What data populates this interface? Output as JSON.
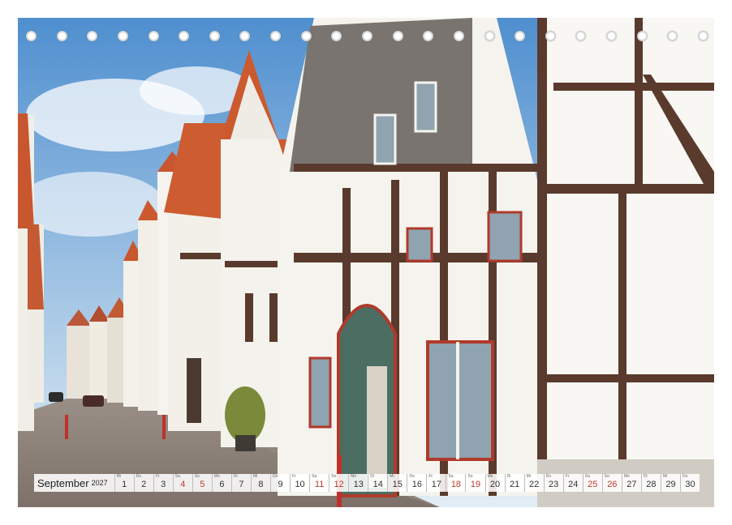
{
  "calendar": {
    "month": "September",
    "year": "2027",
    "weekday_initials": [
      "Mi",
      "Do",
      "Fr",
      "Sa",
      "So",
      "Mo",
      "Di",
      "Mi",
      "Do",
      "Fr",
      "Sa",
      "So",
      "Mo",
      "Di",
      "Mi",
      "Do",
      "Fr",
      "Sa",
      "So",
      "Mo",
      "Di",
      "Mi",
      "Do",
      "Fr",
      "Sa",
      "So",
      "Mo",
      "Di",
      "Mi",
      "Do"
    ],
    "days": [
      "1",
      "2",
      "3",
      "4",
      "5",
      "6",
      "7",
      "8",
      "9",
      "10",
      "11",
      "12",
      "13",
      "14",
      "15",
      "16",
      "17",
      "18",
      "19",
      "20",
      "21",
      "22",
      "23",
      "24",
      "25",
      "26",
      "27",
      "28",
      "29",
      "30"
    ],
    "weekend_days": [
      4,
      5,
      11,
      12,
      18,
      19,
      25,
      26
    ],
    "accent_color": "#c0392b"
  },
  "binding": {
    "ring_count": 23,
    "ring_color": "#ffffff"
  },
  "photo": {
    "sky_color": "#6fa6d6",
    "roof_color": "#c8562e",
    "timber_color": "#5a3a2c",
    "plaster_color": "#f3f1ec"
  }
}
